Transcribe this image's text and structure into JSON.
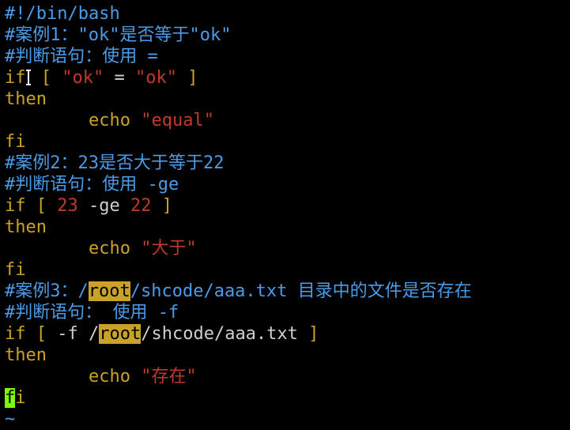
{
  "editor": {
    "lines": [
      {
        "segments": [
          {
            "text": "#!/bin/bash",
            "role": "comment"
          }
        ]
      },
      {
        "segments": [
          {
            "text": "#案例1：\"ok\"是否等于\"ok\"",
            "role": "comment"
          }
        ]
      },
      {
        "segments": [
          {
            "text": "#判断语句：使用 =",
            "role": "comment"
          }
        ]
      },
      {
        "segments": [
          {
            "text": "if",
            "role": "keyword"
          },
          {
            "text": " [ ",
            "role": "bracket"
          },
          {
            "text": "\"",
            "role": "quote"
          },
          {
            "text": "ok",
            "role": "string"
          },
          {
            "text": "\"",
            "role": "quote"
          },
          {
            "text": " = ",
            "role": "plain"
          },
          {
            "text": "\"",
            "role": "quote"
          },
          {
            "text": "ok",
            "role": "string"
          },
          {
            "text": "\"",
            "role": "quote"
          },
          {
            "text": " ]",
            "role": "bracket"
          }
        ]
      },
      {
        "segments": [
          {
            "text": "then",
            "role": "keyword"
          }
        ]
      },
      {
        "segments": [
          {
            "text": "        ",
            "role": "plain"
          },
          {
            "text": "echo",
            "role": "echo"
          },
          {
            "text": " ",
            "role": "plain"
          },
          {
            "text": "\"",
            "role": "quote"
          },
          {
            "text": "equal",
            "role": "string"
          },
          {
            "text": "\"",
            "role": "quote"
          }
        ]
      },
      {
        "segments": [
          {
            "text": "fi",
            "role": "keyword"
          }
        ]
      },
      {
        "segments": [
          {
            "text": "#案例2：23是否大于等于22",
            "role": "comment"
          }
        ]
      },
      {
        "segments": [
          {
            "text": "#判断语句：使用 -ge",
            "role": "comment"
          }
        ]
      },
      {
        "segments": [
          {
            "text": "if",
            "role": "keyword"
          },
          {
            "text": " [ ",
            "role": "bracket"
          },
          {
            "text": "23",
            "role": "num"
          },
          {
            "text": " -ge ",
            "role": "plain"
          },
          {
            "text": "22",
            "role": "num"
          },
          {
            "text": " ]",
            "role": "bracket"
          }
        ]
      },
      {
        "segments": [
          {
            "text": "then",
            "role": "keyword"
          }
        ]
      },
      {
        "segments": [
          {
            "text": "        ",
            "role": "plain"
          },
          {
            "text": "echo",
            "role": "echo"
          },
          {
            "text": " ",
            "role": "plain"
          },
          {
            "text": "\"",
            "role": "quote"
          },
          {
            "text": "大于",
            "role": "string"
          },
          {
            "text": "\"",
            "role": "quote"
          }
        ]
      },
      {
        "segments": [
          {
            "text": "fi",
            "role": "keyword"
          }
        ]
      },
      {
        "segments": [
          {
            "text": "#案例3：/",
            "role": "comment"
          },
          {
            "text": "root",
            "role": "highlight"
          },
          {
            "text": "/shcode/aaa.txt 目录中的文件是否存在",
            "role": "comment"
          }
        ]
      },
      {
        "segments": [
          {
            "text": "#判断语句： 使用 -f",
            "role": "comment"
          }
        ]
      },
      {
        "segments": [
          {
            "text": "if",
            "role": "keyword"
          },
          {
            "text": " [ ",
            "role": "bracket"
          },
          {
            "text": "-f ",
            "role": "plain"
          },
          {
            "text": "/",
            "role": "plain"
          },
          {
            "text": "root",
            "role": "highlight"
          },
          {
            "text": "/shcode/aaa.txt",
            "role": "plain"
          },
          {
            "text": " ]",
            "role": "bracket"
          }
        ]
      },
      {
        "segments": [
          {
            "text": "then",
            "role": "keyword"
          }
        ]
      },
      {
        "segments": [
          {
            "text": "        ",
            "role": "plain"
          },
          {
            "text": "echo",
            "role": "echo"
          },
          {
            "text": " ",
            "role": "plain"
          },
          {
            "text": "\"",
            "role": "quote"
          },
          {
            "text": "存在",
            "role": "string"
          },
          {
            "text": "\"",
            "role": "quote"
          }
        ]
      },
      {
        "segments": [
          {
            "text": "f",
            "role": "cursor"
          },
          {
            "text": "i",
            "role": "keyword"
          }
        ]
      },
      {
        "segments": [
          {
            "text": "~",
            "role": "tilde"
          }
        ]
      }
    ]
  },
  "colors": {
    "background": "#000000",
    "comment": "#4a9be8",
    "keyword": "#c9a227",
    "string": "#c0392b",
    "highlight_bg": "#c9a227",
    "cursor_bg": "#7cfc00"
  }
}
